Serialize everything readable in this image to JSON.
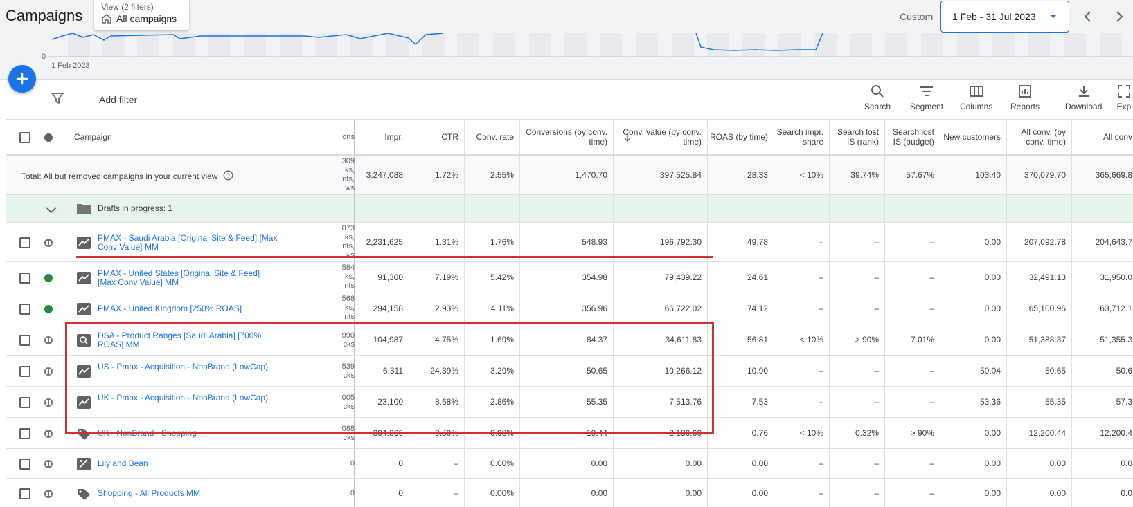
{
  "header": {
    "title": "Campaigns",
    "view_label": "View (2 filters)",
    "view_value": "All campaigns",
    "custom_label": "Custom",
    "date_range": "1 Feb - 31 Jul 2023"
  },
  "chart": {
    "zero_label": "0",
    "start_date_label": "1 Feb 2023"
  },
  "toolbar": {
    "add_filter": "Add filter",
    "tools": [
      "Search",
      "Segment",
      "Columns",
      "Reports",
      "Download",
      "Exp"
    ]
  },
  "columns": {
    "campaign": "Campaign",
    "clipped": "ons",
    "headers": [
      "Impr.",
      "CTR",
      "Conv. rate",
      "Conversions (by conv. time)",
      "Conv. value (by conv. time)",
      "ROAS (by time)",
      "Search impr. share",
      "Search lost IS (rank)",
      "Search lost IS (budget)",
      "New customers",
      "All conv. (by conv. time)",
      "All conv"
    ]
  },
  "total": {
    "label": "Total: All but removed campaigns in your current view",
    "clipped": "309 ks, nts, ws",
    "values": [
      "3,247,088",
      "1.72%",
      "2.55%",
      "1,470.70",
      "397,525.84",
      "28.33",
      "< 10%",
      "39.74%",
      "57.67%",
      "103.40",
      "370,079.70",
      "365,669.8"
    ]
  },
  "drafts": {
    "label": "Drafts in progress: 1"
  },
  "rows": [
    {
      "name": "PMAX - Saudi Arabia [Original Site & Feed] [Max Conv Value] MM",
      "status": "paused",
      "icon": "performance-max-icon",
      "clipped": "073 ks, nts, ws",
      "values": [
        "2,231,625",
        "1.31%",
        "1.76%",
        "548.93",
        "196,792.30",
        "49.78",
        "–",
        "–",
        "–",
        "0.00",
        "207,092.78",
        "204,643.7"
      ]
    },
    {
      "name": "PMAX - United States [Original Site & Feed] [Max Conv Value] MM",
      "status": "enabled",
      "icon": "performance-max-icon",
      "clipped": "584 ks, nts",
      "values": [
        "91,300",
        "7.19%",
        "5.42%",
        "354.98",
        "79,439.22",
        "24.61",
        "–",
        "–",
        "–",
        "0.00",
        "32,491.13",
        "31,950.0"
      ]
    },
    {
      "name": "PMAX - United Kingdom [250% ROAS]",
      "status": "enabled",
      "icon": "performance-max-icon",
      "clipped": "568 ks, nts",
      "values": [
        "294,158",
        "2.93%",
        "4.11%",
        "356.96",
        "66,722.02",
        "74.12",
        "–",
        "–",
        "–",
        "0.00",
        "65,100.96",
        "63,712.1"
      ]
    },
    {
      "name": "DSA - Product Ranges [Saudi Arabia] [700% ROAS] MM",
      "status": "paused",
      "icon": "search-campaign-icon",
      "clipped": "990 cks",
      "values": [
        "104,987",
        "4.75%",
        "1.69%",
        "84.37",
        "34,611.83",
        "56.81",
        "< 10%",
        "> 90%",
        "7.01%",
        "0.00",
        "51,388.37",
        "51,355.3"
      ]
    },
    {
      "name": "US - Pmax - Acquisition - NonBrand (LowCap)",
      "status": "paused",
      "icon": "performance-max-icon",
      "clipped": "539 cks",
      "values": [
        "6,311",
        "24.39%",
        "3.29%",
        "50.65",
        "10,266.12",
        "10.90",
        "–",
        "–",
        "–",
        "50.04",
        "50.65",
        "50.6"
      ]
    },
    {
      "name": "UK - Pmax - Acquisition - NonBrand (LowCap)",
      "status": "paused",
      "icon": "performance-max-icon",
      "clipped": "005 cks",
      "values": [
        "23,100",
        "8.68%",
        "2.86%",
        "55.35",
        "7,513.76",
        "7.53",
        "–",
        "–",
        "–",
        "53.36",
        "55.35",
        "57.3"
      ]
    },
    {
      "name": "UK - NonBrand - Shopping",
      "status": "paused",
      "icon": "shopping-tag-icon",
      "clipped": "088 cks",
      "values": [
        "394,366",
        "0.50%",
        "0.98%",
        "19.44",
        "2,180.60",
        "0.76",
        "< 10%",
        "0.32%",
        "> 90%",
        "0.00",
        "12,200.44",
        "12,200.4"
      ]
    },
    {
      "name": "Lily and Bean",
      "status": "paused",
      "icon": "smart-campaign-icon",
      "clipped": "0",
      "values": [
        "0",
        "–",
        "0.00%",
        "0.00",
        "0.00",
        "0.00",
        "–",
        "–",
        "–",
        "0.00",
        "0.00",
        "0.0"
      ]
    },
    {
      "name": "Shopping - All Products MM",
      "status": "paused",
      "icon": "shopping-tag-icon",
      "clipped": "0",
      "values": [
        "0",
        "–",
        "0.00%",
        "0.00",
        "0.00",
        "0.00",
        "–",
        "–",
        "–",
        "0.00",
        "0.00",
        "0.0"
      ]
    }
  ],
  "colors": {
    "accent": "#1a73e8",
    "enabled": "#1e8e3e",
    "annotation": "#d32f2f",
    "drafts_bg": "#e6f4ea"
  }
}
